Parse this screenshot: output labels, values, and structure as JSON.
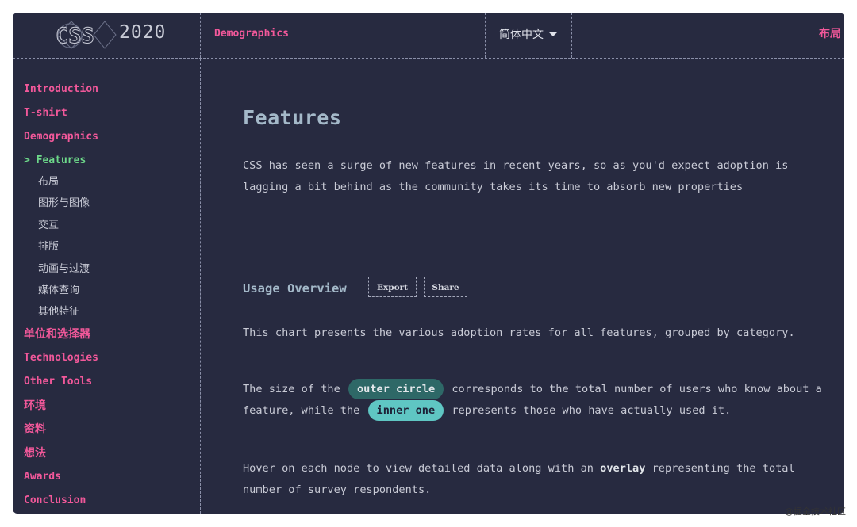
{
  "header": {
    "logo_year": "2020",
    "section": "Demographics",
    "language": "简体中文",
    "right_link": "布局"
  },
  "sidebar": {
    "items": [
      {
        "label": "Introduction"
      },
      {
        "label": "T-shirt"
      },
      {
        "label": "Demographics"
      },
      {
        "label": "> Features",
        "active": true
      },
      {
        "label": "布局",
        "sub": true
      },
      {
        "label": "图形与图像",
        "sub": true
      },
      {
        "label": "交互",
        "sub": true
      },
      {
        "label": "排版",
        "sub": true
      },
      {
        "label": "动画与过渡",
        "sub": true
      },
      {
        "label": "媒体查询",
        "sub": true
      },
      {
        "label": "其他特征",
        "sub": true
      },
      {
        "label": "单位和选择器"
      },
      {
        "label": "Technologies"
      },
      {
        "label": "Other Tools"
      },
      {
        "label": "环境"
      },
      {
        "label": "资料"
      },
      {
        "label": "想法"
      },
      {
        "label": "Awards"
      },
      {
        "label": "Conclusion"
      }
    ]
  },
  "main": {
    "title": "Features",
    "intro": "CSS has seen a surge of new features in recent years, so as you'd expect adoption is lagging a bit behind as the community takes its time to absorb new properties",
    "section_title": "Usage Overview",
    "export_label": "Export",
    "share_label": "Share",
    "p1": "This chart presents the various adoption rates for all features, grouped by category.",
    "p2_a": "The size of the",
    "p2_pill_outer": "outer circle",
    "p2_b": "corresponds to the total number of users who know about a feature, while the",
    "p2_pill_inner": "inner one",
    "p2_c": "represents those who have actually used it.",
    "p3_a": "Hover on each node to view detailed data along with an",
    "p3_bold": "overlay",
    "p3_b": "representing the total number of survey respondents."
  },
  "watermark": "@掘金技术社区",
  "colors": {
    "background": "#272a40",
    "accent_pink": "#f2589a",
    "active_green": "#6dd98a",
    "title_blue": "#a4b9c9",
    "pill_outer": "#2e6867",
    "pill_inner": "#5fc6c3"
  }
}
